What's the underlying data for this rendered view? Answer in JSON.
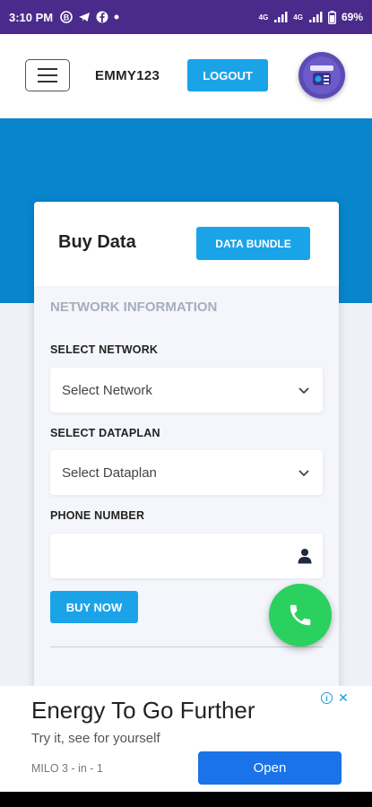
{
  "status_bar": {
    "time": "3:10 PM",
    "battery": "69%",
    "network_label_1": "4G",
    "network_label_2": "4G"
  },
  "header": {
    "username": "EMMY123",
    "logout_label": "LOGOUT"
  },
  "card": {
    "title": "Buy Data",
    "bundle_button_label": "DATA BUNDLE",
    "section_heading": "NETWORK INFORMATION",
    "network_label": "SELECT NETWORK",
    "network_value": "Select Network",
    "dataplan_label": "SELECT DATAPLAN",
    "dataplan_value": "Select Dataplan",
    "phone_label": "PHONE NUMBER",
    "phone_value": "",
    "buy_button_label": "BUY NOW"
  },
  "ad": {
    "title": "Energy To Go Further",
    "subtitle": "Try it, see for yourself",
    "brand": "MILO 3 - in - 1",
    "open_label": "Open"
  },
  "colors": {
    "primary": "#1ba3e8",
    "band": "#0885cc",
    "status_bar": "#4a2a8a",
    "fab": "#2bd15f",
    "ad_button": "#1a73e8"
  }
}
